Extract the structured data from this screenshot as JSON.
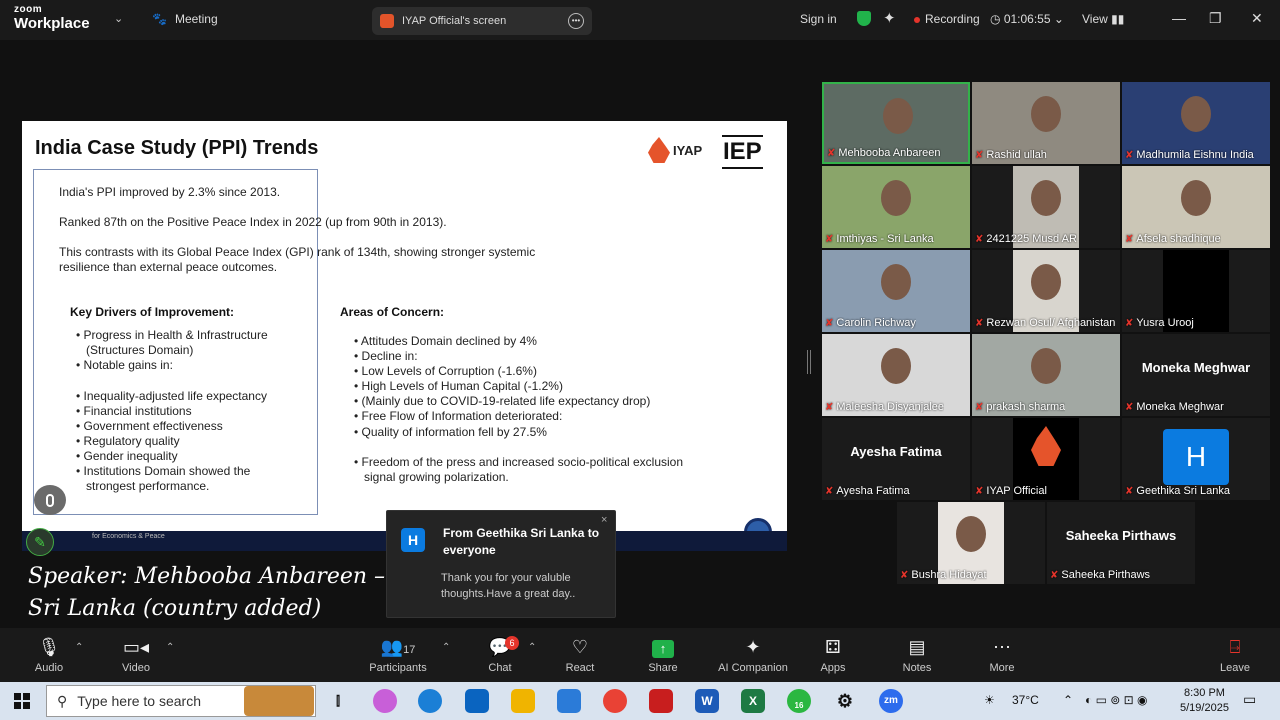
{
  "topbar": {
    "brand_top": "zoom",
    "brand_bottom": "Workplace",
    "meeting_label": "Meeting",
    "screen_label": "IYAP Official's screen",
    "sign_in": "Sign in",
    "recording_label": "Recording",
    "timer": "01:06:55",
    "view_label": "View",
    "colors": {
      "recording": "#e5342b",
      "secure": "#21b34b"
    }
  },
  "slide": {
    "title": "India Case Study (PPI) Trends",
    "logo_iyap": "IYAP",
    "logo_iep": "IEP",
    "intro": [
      "India's PPI improved by 2.3% since 2013.",
      "Ranked 87th on the Positive Peace Index in 2022 (up from 90th in 2013).",
      "This contrasts with its Global Peace Index (GPI) rank of 134th, showing stronger systemic",
      "resilience than external peace outcomes."
    ],
    "drivers_heading": "Key Drivers of Improvement:",
    "drivers": [
      "• Progress in Health & Infrastructure",
      "(Structures Domain)",
      "• Notable gains in:",
      "• Inequality-adjusted life expectancy",
      "• Financial institutions",
      "• Government effectiveness",
      "• Regulatory quality",
      "• Gender inequality",
      "• Institutions Domain showed the",
      "strongest performance."
    ],
    "concern_heading": "Areas of Concern:",
    "concerns": [
      "• Attitudes Domain declined by 4%",
      "• Decline in:",
      "• Low Levels of Corruption (-1.6%)",
      "• High Levels of Human Capital (-1.2%)",
      "• (Mainly due to COVID-19-related life expectancy drop)",
      "• Free Flow of Information deteriorated:",
      "• Quality of information fell by 27.5%",
      "• Freedom of the press and increased socio-political exclusion",
      "signal growing polarization."
    ],
    "footer": "for Economics & Peace"
  },
  "caption": {
    "line1": "Speaker: Mehbooba Anbareen –",
    "line2": "Sri Lanka (country added)"
  },
  "chat_popup": {
    "avatar": "H",
    "from": "From Geethika Sri Lanka to everyone",
    "message": "Thank you for your valuble thoughts.Have a great day..",
    "close": "×"
  },
  "gallery": [
    {
      "name": "Mehbooba Anbareen",
      "big": "",
      "active": true,
      "bg": "#5d6b63"
    },
    {
      "name": "Rashid ullah",
      "big": "",
      "active": false,
      "bg": "#8f8a80"
    },
    {
      "name": "Madhumila Eishnu India",
      "big": "",
      "active": false,
      "bg": "#2a3f73"
    },
    {
      "name": "Imthiyas - Sri Lanka",
      "big": "",
      "active": false,
      "bg": "#8aa56a"
    },
    {
      "name": "2421225 Musd AR",
      "big": "",
      "active": false,
      "bg": "#bfbcb4"
    },
    {
      "name": "Afsela shadhique",
      "big": "",
      "active": false,
      "bg": "#cbc6b6"
    },
    {
      "name": "Carolin Richway",
      "big": "",
      "active": false,
      "bg": "#8a9cb0"
    },
    {
      "name": "Rezwan Osul/ Afghanistan",
      "big": "",
      "active": false,
      "bg": "#d8d5ce"
    },
    {
      "name": "Yusra Urooj",
      "big": "",
      "active": false,
      "bg": "#000000"
    },
    {
      "name": "Maleesha Disyanjalee",
      "big": "",
      "active": false,
      "bg": "#d8d8d8"
    },
    {
      "name": "prakash sharma",
      "big": "",
      "active": false,
      "bg": "#a2a8a3"
    },
    {
      "name": "Moneka Meghwar",
      "big": "Moneka Meghwar",
      "active": false,
      "bg": "#1b1b1b"
    },
    {
      "name": "Ayesha Fatima",
      "big": "Ayesha Fatima",
      "active": false,
      "bg": "#1b1b1b"
    },
    {
      "name": "IYAP Official",
      "big": "",
      "active": false,
      "bg": "#1b1b1b"
    },
    {
      "name": "Geethika Sri Lanka",
      "big": "",
      "active": false,
      "bg": "#1b1b1b",
      "avatar_letter": "H"
    },
    {
      "name": "Bushra Hidayat",
      "big": "",
      "active": false,
      "bg": "#e8e4e0"
    },
    {
      "name": "Saheeka Pirthaws",
      "big": "Saheeka Pirthaws",
      "active": false,
      "bg": "#1b1b1b"
    }
  ],
  "toolbar": {
    "audio": "Audio",
    "video": "Video",
    "participants": "Participants",
    "participants_count": "17",
    "chat": "Chat",
    "chat_badge": "6",
    "react": "React",
    "share": "Share",
    "ai": "AI Companion",
    "apps": "Apps",
    "notes": "Notes",
    "more": "More",
    "leave": "Leave"
  },
  "taskbar": {
    "search_placeholder": "Type here to search",
    "weather": "37°C",
    "whatsapp_badge": "16",
    "time": "8:30 PM",
    "date": "5/19/2025",
    "word": "W",
    "excel": "X",
    "zoom": "zm"
  }
}
